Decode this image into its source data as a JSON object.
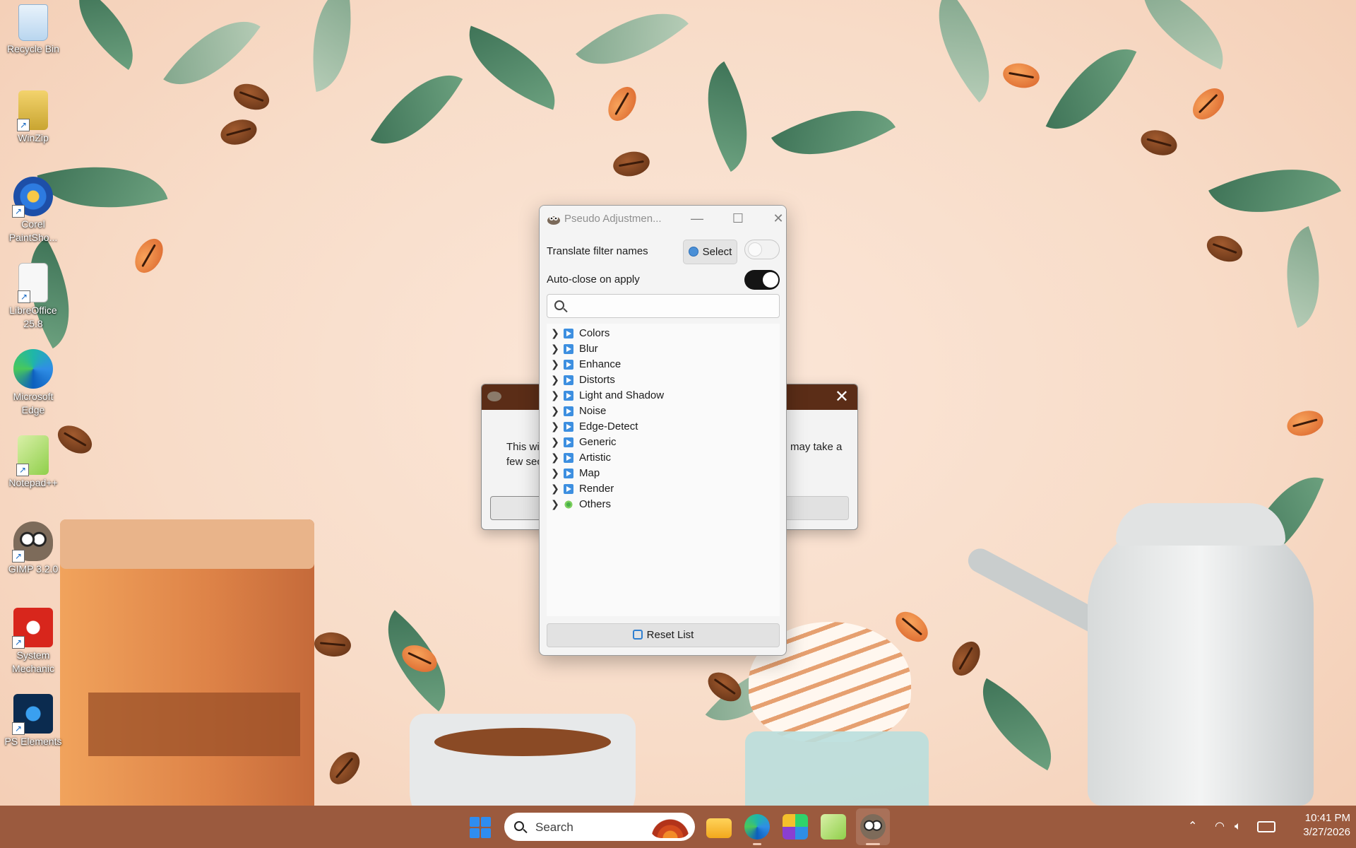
{
  "desktop": {
    "icons": [
      {
        "label": "Recycle Bin",
        "icon": "recycle-bin-icon"
      },
      {
        "label": "WinZip",
        "icon": "winzip-icon"
      },
      {
        "label": "Corel PaintSho...",
        "icon": "corel-paintshop-icon"
      },
      {
        "label": "LibreOffice 25.8",
        "icon": "libreoffice-icon"
      },
      {
        "label": "Microsoft Edge",
        "icon": "edge-icon"
      },
      {
        "label": "Notepad++",
        "icon": "notepadpp-icon"
      },
      {
        "label": "GIMP 3.2.0",
        "icon": "gimp-icon"
      },
      {
        "label": "System Mechanic",
        "icon": "system-mechanic-icon"
      },
      {
        "label": "PS Elements",
        "icon": "ps-elements-icon"
      }
    ]
  },
  "background_dialog": {
    "message_start": "This wi",
    "message_end": "may take a",
    "message_line2": "few sec"
  },
  "window": {
    "title": "Pseudo Adjustmen...",
    "translate_label": "Translate filter names",
    "select_label": "Select",
    "translate_on": false,
    "autoclose_label": "Auto-close on apply",
    "autoclose_on": true,
    "search_value": "",
    "categories": [
      {
        "name": "Colors",
        "icon": "filter-category-icon"
      },
      {
        "name": "Blur",
        "icon": "filter-category-icon"
      },
      {
        "name": "Enhance",
        "icon": "filter-category-icon"
      },
      {
        "name": "Distorts",
        "icon": "filter-category-icon"
      },
      {
        "name": "Light and Shadow",
        "icon": "filter-category-icon"
      },
      {
        "name": "Noise",
        "icon": "filter-category-icon"
      },
      {
        "name": "Edge-Detect",
        "icon": "filter-category-icon"
      },
      {
        "name": "Generic",
        "icon": "filter-category-icon"
      },
      {
        "name": "Artistic",
        "icon": "filter-category-icon"
      },
      {
        "name": "Map",
        "icon": "filter-category-icon"
      },
      {
        "name": "Render",
        "icon": "filter-category-icon"
      },
      {
        "name": "Others",
        "icon": "others-category-icon"
      }
    ],
    "reset_label": "Reset List"
  },
  "taskbar": {
    "search_label": "Search",
    "time": "10:41 PM",
    "date": "3/27/2026"
  }
}
